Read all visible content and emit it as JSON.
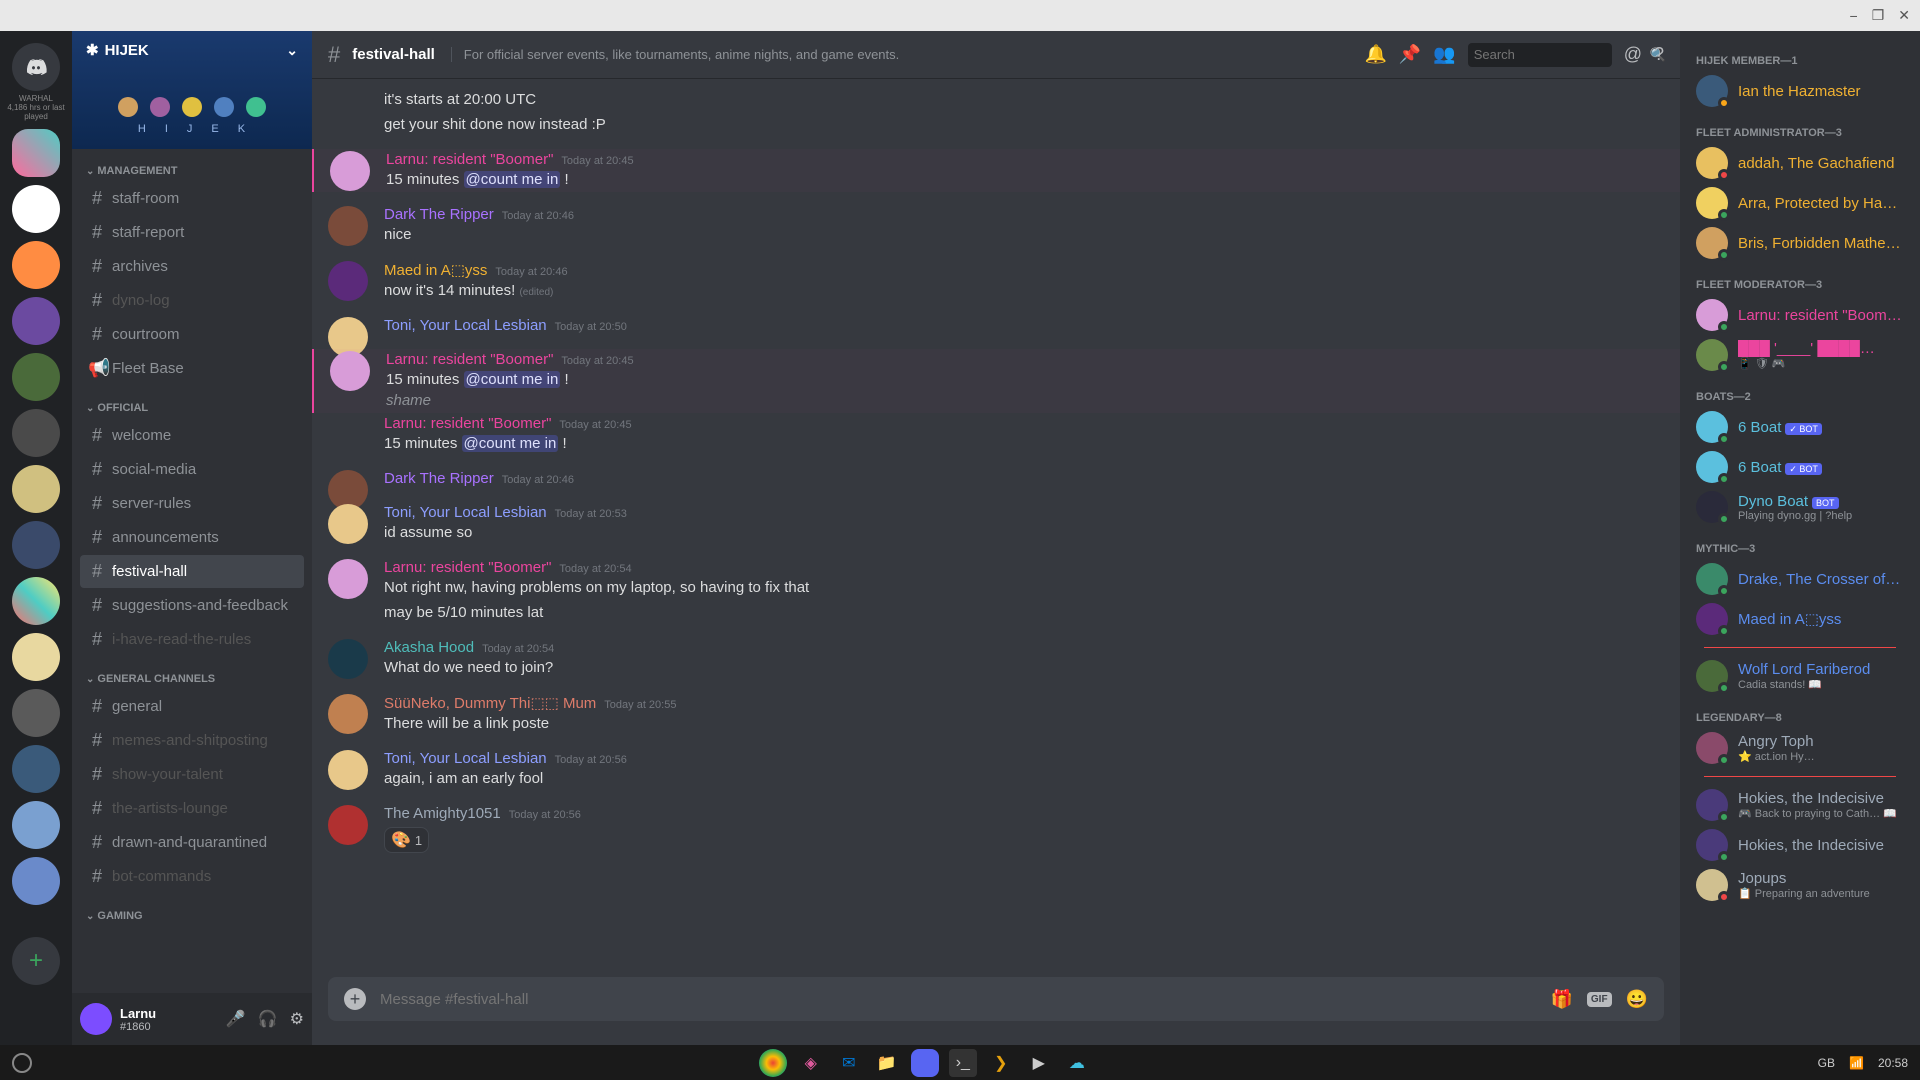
{
  "window": {
    "min": "−",
    "max": "❐",
    "close": "✕"
  },
  "server": {
    "name": "HIJEK",
    "letters": [
      "H",
      "I",
      "J",
      "E",
      "K"
    ]
  },
  "categories": [
    {
      "name": "MANAGEMENT",
      "channels": [
        {
          "icon": "#",
          "name": "staff-room",
          "state": "normal"
        },
        {
          "icon": "#",
          "name": "staff-report",
          "state": "normal"
        },
        {
          "icon": "#",
          "name": "archives",
          "state": "normal"
        },
        {
          "icon": "#",
          "name": "dyno-log",
          "state": "muted"
        },
        {
          "icon": "#",
          "name": "courtroom",
          "state": "normal"
        },
        {
          "icon": "📢",
          "name": "Fleet Base",
          "state": "normal"
        }
      ]
    },
    {
      "name": "OFFICIAL",
      "channels": [
        {
          "icon": "#",
          "name": "welcome",
          "state": "normal"
        },
        {
          "icon": "#",
          "name": "social-media",
          "state": "normal"
        },
        {
          "icon": "#",
          "name": "server-rules",
          "state": "normal"
        },
        {
          "icon": "#",
          "name": "announcements",
          "state": "normal"
        },
        {
          "icon": "#",
          "name": "festival-hall",
          "state": "active"
        },
        {
          "icon": "#",
          "name": "suggestions-and-feedback",
          "state": "normal"
        },
        {
          "icon": "#",
          "name": "i-have-read-the-rules",
          "state": "muted"
        }
      ]
    },
    {
      "name": "GENERAL CHANNELS",
      "channels": [
        {
          "icon": "#",
          "name": "general",
          "state": "normal"
        },
        {
          "icon": "#",
          "name": "memes-and-shitposting",
          "state": "muted"
        },
        {
          "icon": "#",
          "name": "show-your-talent",
          "state": "muted"
        },
        {
          "icon": "#",
          "name": "the-artists-lounge",
          "state": "muted"
        },
        {
          "icon": "#",
          "name": "drawn-and-quarantined",
          "state": "normal"
        },
        {
          "icon": "#",
          "name": "bot-commands",
          "state": "muted"
        }
      ]
    },
    {
      "name": "GAMING",
      "channels": []
    }
  ],
  "userPanel": {
    "name": "Larnu",
    "disc": "#1860"
  },
  "header": {
    "channel": "festival-hall",
    "topic": "For official server events, like tournaments, anime nights, and game events.",
    "searchPlaceholder": "Search"
  },
  "colors": {
    "larnu": "#eb459e",
    "dark": "#a972ff",
    "maed": "#f0b132",
    "toni": "#8d9eff",
    "akasha": "#4fbdba",
    "suu": "#de7c6a",
    "amighty": "#9eaab8"
  },
  "messages": [
    {
      "type": "body",
      "text": "it's starts at 20:00 UTC"
    },
    {
      "type": "body",
      "text": "get your shit done now instead :P"
    },
    {
      "type": "msg",
      "av": "#d89cd8",
      "author": "Larnu: resident \"Boomer\"",
      "colorKey": "larnu",
      "ts": "Today at 20:45",
      "body": "15 minutes ",
      "mention": "@count me in",
      "tail": " !",
      "reply": true
    },
    {
      "type": "msg",
      "av": "#7a4b3a",
      "author": "Dark The Ripper",
      "colorKey": "dark",
      "ts": "Today at 20:46",
      "body": "nice"
    },
    {
      "type": "msg",
      "av": "#5b2a7a",
      "author": "Maed in A⬚yss",
      "colorKey": "maed",
      "ts": "Today at 20:46",
      "body": "now it's 14 minutes! ",
      "edited": true
    },
    {
      "type": "msg",
      "av": "#e8c88a",
      "author": "Toni, Your Local Lesbian",
      "colorKey": "toni",
      "ts": "Today at 20:50",
      "body": "",
      "tight": false
    },
    {
      "type": "replybox",
      "av": "#d89cd8",
      "author": "Larnu: resident \"Boomer\"",
      "colorKey": "larnu",
      "ts": "Today at 20:45",
      "body": "15 minutes ",
      "mention": "@count me in",
      "tail": " !",
      "italic": "shame"
    },
    {
      "type": "msg",
      "av": "#5b2a7a",
      "author": "Larnu: resident \"Boomer\"",
      "colorKey": "larnu",
      "ts": "Today at 20:45",
      "body": "15 minutes ",
      "mention": "@count me in",
      "tail": " !",
      "tight": true,
      "noav": true
    },
    {
      "type": "msg",
      "av": "#7a4b3a",
      "author": "Dark The Ripper",
      "colorKey": "dark",
      "ts": "Today at 20:46",
      "body": ""
    },
    {
      "type": "msg",
      "av": "#e8c88a",
      "author": "Toni, Your Local Lesbian",
      "colorKey": "toni",
      "ts": "Today at 20:53",
      "body": "id assume so"
    },
    {
      "type": "msg",
      "av": "#d89cd8",
      "author": "Larnu: resident \"Boomer\"",
      "colorKey": "larnu",
      "ts": "Today at 20:54",
      "body": "Not right nw, having problems on my laptop, so having to fix that"
    },
    {
      "type": "body",
      "text": "may be 5/10 minutes lat"
    },
    {
      "type": "msg",
      "av": "#1a3a4a",
      "author": "Akasha Hood",
      "colorKey": "akasha",
      "ts": "Today at 20:54",
      "body": "What do we need to join?"
    },
    {
      "type": "msg",
      "av": "#c08050",
      "author": "SüüNeko, Dummy Thi⬚⬚ Mum",
      "colorKey": "suu",
      "ts": "Today at 20:55",
      "body": "There will be a link poste"
    },
    {
      "type": "msg",
      "av": "#e8c88a",
      "author": "Toni, Your Local Lesbian",
      "colorKey": "toni",
      "ts": "Today at 20:56",
      "body": "again, i am an early fool"
    },
    {
      "type": "msg",
      "av": "#b03030",
      "author": "The Amighty1051",
      "colorKey": "amighty",
      "ts": "Today at 20:56",
      "body": "",
      "react": {
        "emoji": "🎨",
        "count": "1"
      }
    }
  ],
  "inputPlaceholder": "Message #festival-hall",
  "roles": [
    {
      "header": "HIJEK MEMBER—1",
      "color": "#f0b132",
      "members": [
        {
          "name": "Ian the Hazmaster",
          "status": "",
          "st": "#faa61a",
          "av": "#3a5a7a"
        }
      ]
    },
    {
      "header": "FLEET ADMINISTRATOR—3",
      "color": "#f0b132",
      "members": [
        {
          "name": "addah, The Gachafiend",
          "status": "",
          "st": "#f04747",
          "av": "#e8c060"
        },
        {
          "name": "Arra, Protected by Ha…",
          "status": "",
          "st": "#3ba55d",
          "av": "#f0d060"
        },
        {
          "name": "Bris, Forbidden Mathe…",
          "status": "",
          "st": "#3ba55d",
          "av": "#d0a060"
        }
      ]
    },
    {
      "header": "FLEET MODERATOR—3",
      "color": "#eb459e",
      "members": [
        {
          "name": "Larnu: resident \"Boom…",
          "status": "",
          "st": "#3ba55d",
          "av": "#d89cd8"
        },
        {
          "name": "███ '____' ████…",
          "status": "📱 🛡 🎮",
          "st": "#3ba55d",
          "av": "#6a8a4a"
        }
      ]
    },
    {
      "header": "BOATS—2",
      "color": "#5bc0de",
      "members": [
        {
          "name": "6 Boat",
          "status": "",
          "bot": "✓ BOT",
          "st": "#3ba55d",
          "av": "#5bc0de"
        },
        {
          "name": "6 Boat",
          "status": "",
          "bot": "✓ BOT",
          "st": "#3ba55d",
          "av": "#5bc0de"
        },
        {
          "name": "Dyno Boat",
          "status": "Playing dyno.gg | ?help",
          "bot": "BOT",
          "st": "#3ba55d",
          "av": "#2a2a3a"
        }
      ]
    },
    {
      "header": "MYTHIC—3",
      "color": "#5b8def",
      "members": [
        {
          "name": "Drake, The Crosser of …",
          "status": "",
          "st": "#3ba55d",
          "av": "#3a8a6a"
        },
        {
          "name": "Maed in A⬚yss",
          "status": "",
          "st": "#3ba55d",
          "av": "#5b2a7a",
          "divider": true
        },
        {
          "name": "Wolf Lord Fariberod",
          "status": "Cadia stands! 📖",
          "st": "#3ba55d",
          "av": "#4a6a3a"
        }
      ]
    },
    {
      "header": "LEGENDARY—8",
      "color": "#9eaab8",
      "members": [
        {
          "name": "Angry Toph",
          "status": "⭐ act.ion Hy…",
          "st": "#3ba55d",
          "av": "#8a4a6a",
          "divider": true
        },
        {
          "name": "Hokies, the Indecisive",
          "status": "🎮 Back to praying to Cath… 📖",
          "st": "#3ba55d",
          "av": "#4a3a7a"
        },
        {
          "name": "Hokies, the Indecisive",
          "status": "",
          "st": "#3ba55d",
          "av": "#4a3a7a"
        },
        {
          "name": "Jopups",
          "status": "📋 Preparing an adventure",
          "st": "#f04747",
          "av": "#d0c090"
        }
      ]
    }
  ],
  "guildLabels": {
    "warhal": "WARHAL",
    "sub": "4,186 hrs or last played"
  },
  "taskbar": {
    "lang": "GB",
    "time": "20:58"
  }
}
